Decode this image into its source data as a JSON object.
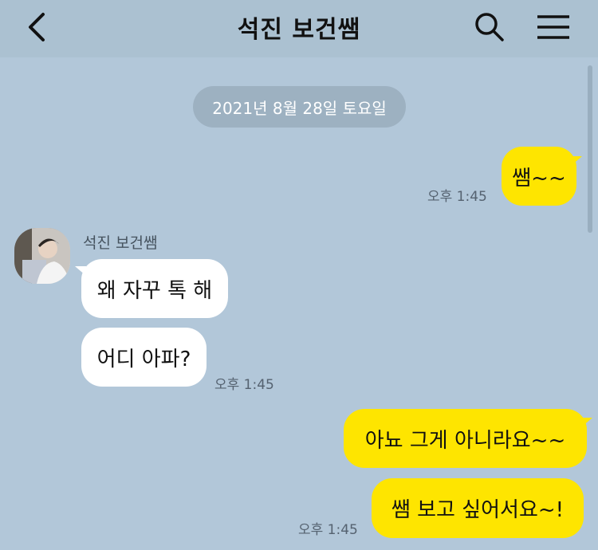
{
  "header": {
    "title": "석진 보건쌤"
  },
  "chat": {
    "date": "2021년 8월 28일 토요일",
    "sender_name": "석진 보건쌤",
    "messages": [
      {
        "from": "me",
        "text": "쌤~~",
        "time": "오후 1:45"
      },
      {
        "from": "other",
        "text": "왜 자꾸 톡 해"
      },
      {
        "from": "other",
        "text": "어디 아파?",
        "time": "오후 1:45"
      },
      {
        "from": "me",
        "text": "아뇨 그게 아니라요~~"
      },
      {
        "from": "me",
        "text": "쌤 보고 싶어서요~!",
        "time": "오후 1:45"
      }
    ]
  },
  "colors": {
    "background": "#b2c7d9",
    "my_bubble": "#fee500",
    "other_bubble": "#ffffff"
  },
  "icons": [
    "back-arrow-icon",
    "search-icon",
    "hamburger-menu-icon"
  ]
}
